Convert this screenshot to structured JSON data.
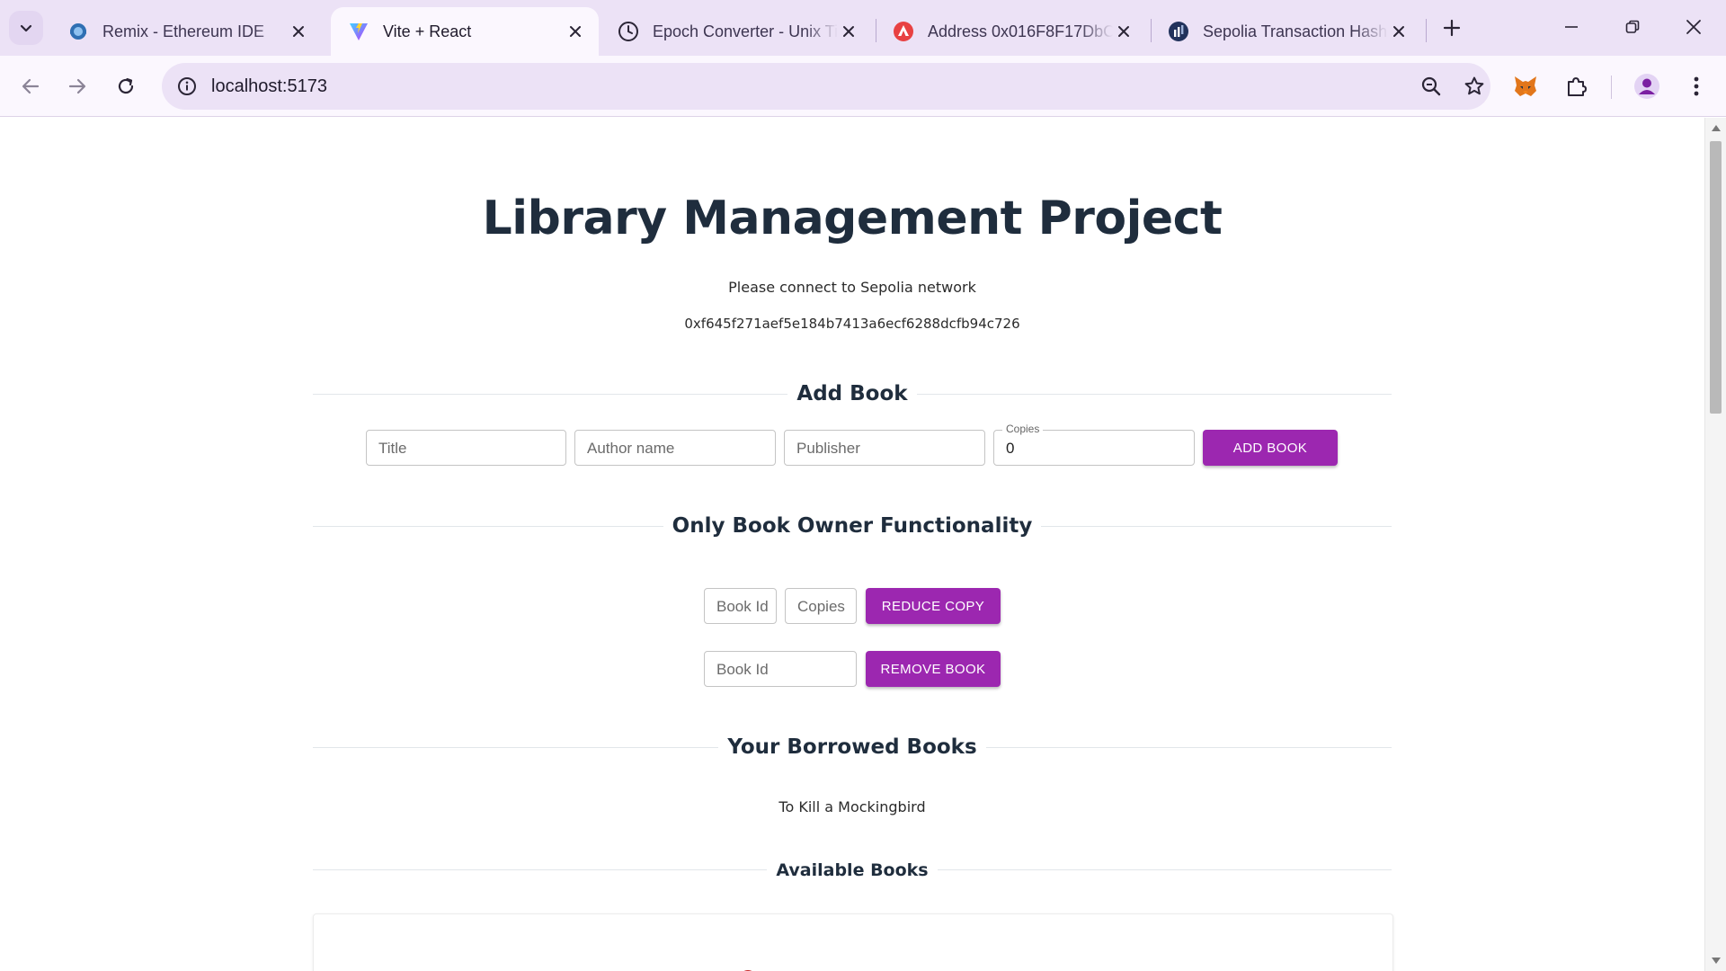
{
  "browser": {
    "tabs": [
      {
        "title": "Remix - Ethereum IDE",
        "favicon": "remix-icon",
        "active": false
      },
      {
        "title": "Vite + React",
        "favicon": "vite-icon",
        "active": true
      },
      {
        "title": "Epoch Converter - Unix Timestamp Converter",
        "favicon": "clock-icon",
        "active": false
      },
      {
        "title": "Address 0x016F8F17DbC",
        "favicon": "avalanche-icon",
        "active": false
      },
      {
        "title": "Sepolia Transaction Hash",
        "favicon": "etherscan-icon",
        "active": false
      }
    ],
    "url": "localhost:5173",
    "colors": {
      "chrome": "#ece2f6",
      "toolbar": "#fbf7fe",
      "active_tab": "#fbf7fe"
    }
  },
  "page": {
    "title": "Library Management Project",
    "network_message": "Please connect to Sepolia network",
    "account_address": "0xf645f271aef5e184b7413a6ecf6288dcfb94c726",
    "add_book": {
      "heading": "Add Book",
      "title_placeholder": "Title",
      "author_placeholder": "Author name",
      "publisher_placeholder": "Publisher",
      "copies_label": "Copies",
      "copies_value": "0",
      "button_label": "ADD BOOK"
    },
    "owner": {
      "heading": "Only Book Owner Functionality",
      "reduce": {
        "book_id_placeholder": "Book Id",
        "copies_placeholder": "Copies",
        "button_label": "REDUCE COPY"
      },
      "remove": {
        "book_id_placeholder": "Book Id",
        "button_label": "REMOVE BOOK"
      }
    },
    "borrowed": {
      "heading": "Your Borrowed Books",
      "books": [
        "To Kill a Mockingbird"
      ]
    },
    "available": {
      "heading": "Available Books"
    },
    "colors": {
      "accent": "#9c27b0",
      "heading": "#1f2d3d"
    }
  }
}
